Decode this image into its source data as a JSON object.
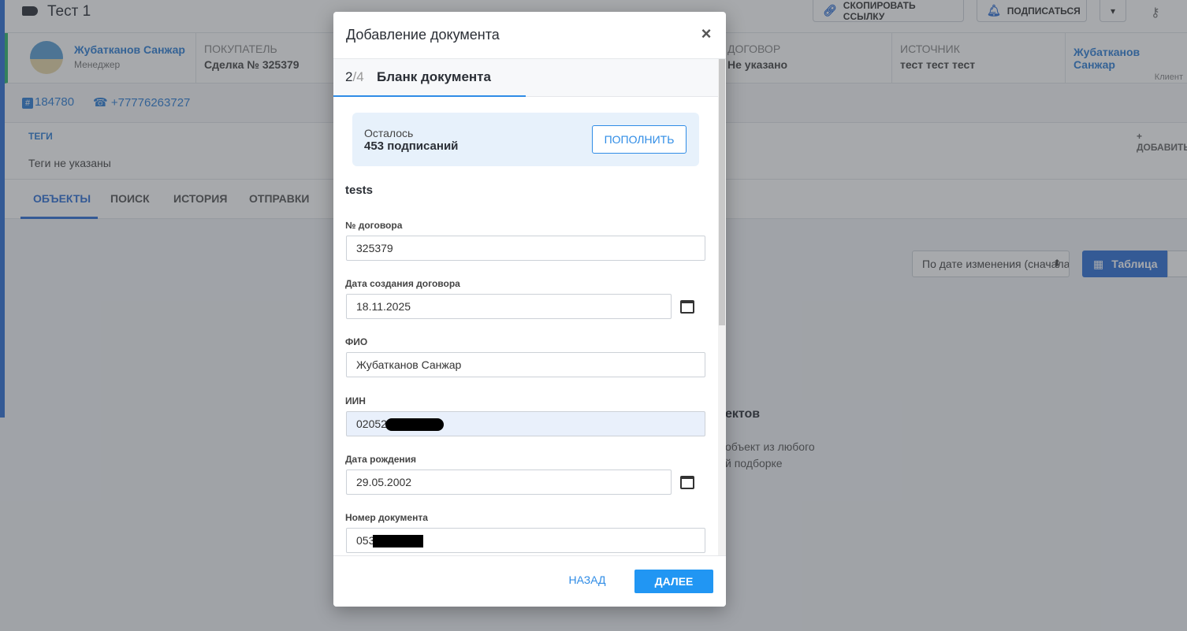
{
  "page": {
    "title": "Тест 1",
    "top_buttons": {
      "copy_link": "СКОПИРОВАТЬ ССЫЛКУ",
      "subscribe": "ПОДПИСАТЬСЯ",
      "more": "▾"
    },
    "manager": {
      "name": "Жубатканов Санжар",
      "role": "Менеджер"
    },
    "info": [
      {
        "key": "ПОКУПАТЕЛЬ",
        "value": "Сделка № 325379"
      },
      {
        "key": "ДОГОВОР",
        "value": "Не указано"
      },
      {
        "key": "ИСТОЧНИК",
        "value": "тест тест тест"
      }
    ],
    "client": {
      "name": "Жубатканов Санжар",
      "role": "Клиент"
    },
    "deal_id": "184780",
    "phone": "+77776263727",
    "tags": {
      "title": "ТЕГИ",
      "empty": "Теги не указаны",
      "add": "+ ДОБАВИТЬ"
    },
    "tabs": [
      "ОБЪЕКТЫ",
      "ПОИСК",
      "ИСТОРИЯ",
      "ОТПРАВКИ"
    ],
    "sort_select": "По дате изменения (сначала новые)",
    "view_table_label": "Таблица",
    "empty_title": "ектов",
    "empty_text_line1": "объект из любого",
    "empty_text_line2": "й подборке"
  },
  "modal": {
    "title": "Добавление документа",
    "close": "×",
    "step": {
      "current": "2",
      "total": "/4",
      "title": "Бланк документа"
    },
    "balance": {
      "label": "Осталось",
      "value": "453 подписаний",
      "topup": "ПОПОЛНИТЬ"
    },
    "section": "tests",
    "fields": {
      "contract_no": {
        "label": "№ договора",
        "value": "325379"
      },
      "contract_date": {
        "label": "Дата создания договора",
        "value": "18.11.2025"
      },
      "fio": {
        "label": "ФИО",
        "value": "Жубатканов Санжар"
      },
      "iin": {
        "label": "ИИН",
        "value": "02052"
      },
      "birth_date": {
        "label": "Дата рождения",
        "value": "29.05.2002"
      },
      "doc_no": {
        "label": "Номер документа",
        "value": "053"
      }
    },
    "footer": {
      "back": "НАЗАД",
      "next": "ДАЛЕЕ"
    }
  },
  "colors": {
    "accent": "#2196f3",
    "primary": "#2f6fd6",
    "balance_bg": "#e7f1fb"
  }
}
